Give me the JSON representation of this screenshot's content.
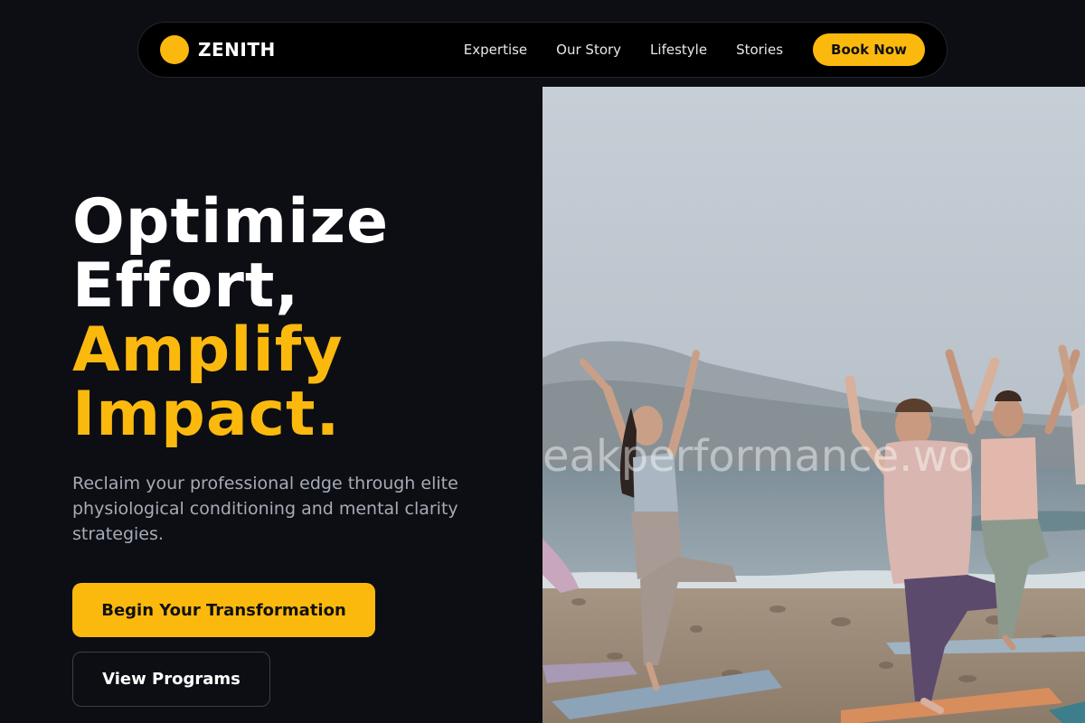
{
  "brand": {
    "name": "ZENITH",
    "accent": "#fcb90d"
  },
  "nav": {
    "links": [
      "Expertise",
      "Our Story",
      "Lifestyle",
      "Stories"
    ],
    "cta": "Book Now"
  },
  "hero": {
    "title_lines": [
      "Optimize",
      "Effort,"
    ],
    "accent_lines": [
      "Amplify",
      "Impact."
    ],
    "subtitle": "Reclaim your professional edge through elite physiological conditioning and mental clarity strategies.",
    "primary_cta": "Begin Your Transformation",
    "secondary_cta": "View Programs"
  },
  "image": {
    "subject": "beach-yoga-class-photo",
    "watermark": "eakperformance.wo"
  },
  "colors": {
    "background": "#0c0e14",
    "nav_bg": "#000000",
    "accent": "#fcb90d",
    "text": "#ffffff",
    "muted": "#a6abb6"
  }
}
